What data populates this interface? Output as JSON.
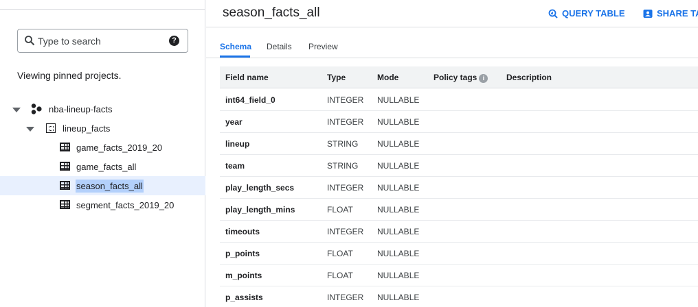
{
  "sidebar": {
    "search": {
      "placeholder": "Type to search"
    },
    "help_symbol": "?",
    "pinned_text": "Viewing pinned projects.",
    "project": {
      "label": "nba-lineup-facts"
    },
    "dataset": {
      "label": "lineup_facts"
    },
    "tables": [
      {
        "label": "game_facts_2019_20"
      },
      {
        "label": "game_facts_all"
      },
      {
        "label": "season_facts_all"
      },
      {
        "label": "segment_facts_2019_20"
      }
    ]
  },
  "header": {
    "title": "season_facts_all",
    "query_button": "QUERY TABLE",
    "share_button": "SHARE TA"
  },
  "tabs": [
    {
      "label": "Schema"
    },
    {
      "label": "Details"
    },
    {
      "label": "Preview"
    }
  ],
  "schema": {
    "columns": {
      "field_name": "Field name",
      "type": "Type",
      "mode": "Mode",
      "policy_tags": "Policy tags",
      "description": "Description"
    },
    "info_symbol": "i",
    "rows": [
      {
        "name": "int64_field_0",
        "type": "INTEGER",
        "mode": "NULLABLE"
      },
      {
        "name": "year",
        "type": "INTEGER",
        "mode": "NULLABLE"
      },
      {
        "name": "lineup",
        "type": "STRING",
        "mode": "NULLABLE"
      },
      {
        "name": "team",
        "type": "STRING",
        "mode": "NULLABLE"
      },
      {
        "name": "play_length_secs",
        "type": "INTEGER",
        "mode": "NULLABLE"
      },
      {
        "name": "play_length_mins",
        "type": "FLOAT",
        "mode": "NULLABLE"
      },
      {
        "name": "timeouts",
        "type": "INTEGER",
        "mode": "NULLABLE"
      },
      {
        "name": "p_points",
        "type": "FLOAT",
        "mode": "NULLABLE"
      },
      {
        "name": "m_points",
        "type": "FLOAT",
        "mode": "NULLABLE"
      },
      {
        "name": "p_assists",
        "type": "INTEGER",
        "mode": "NULLABLE"
      }
    ]
  },
  "colors": {
    "accent": "#1a73e8",
    "selected_row": "#e8f0fe",
    "selection_highlight": "#b3d0fb"
  }
}
